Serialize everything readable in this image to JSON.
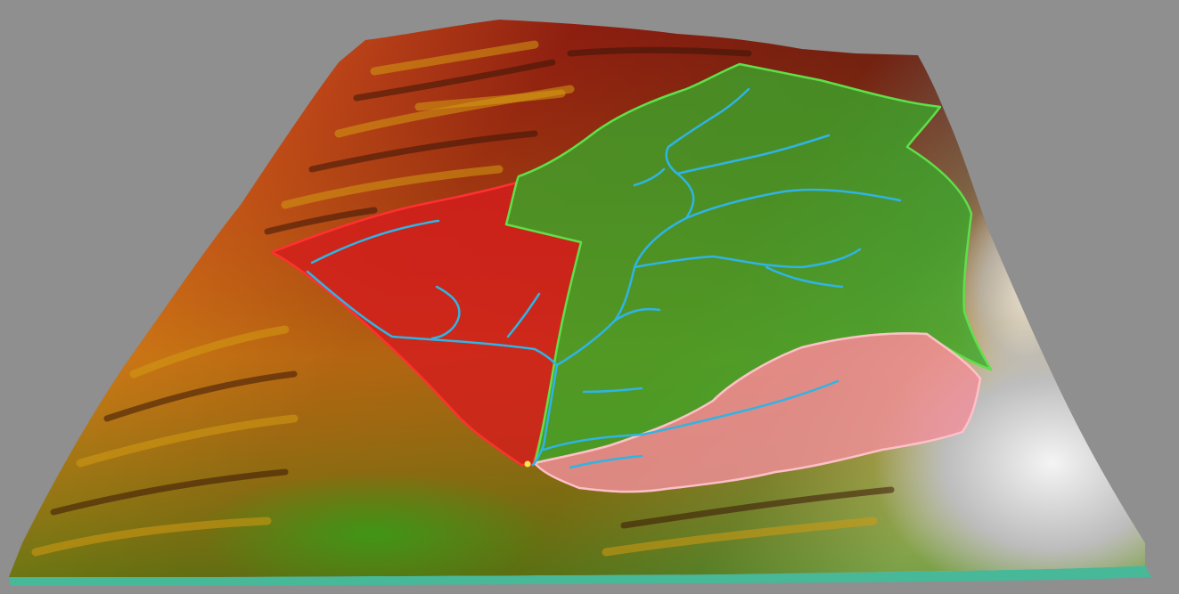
{
  "scene": {
    "background_color": "#8f8f8f",
    "colors": {
      "terrain_low": "#2f7a12",
      "terrain_mid": "#d49a12",
      "terrain_high": "#b51d14",
      "terrain_peak": "#f2f2f2",
      "terrain_shadow": "#3a1608",
      "base_edge": "#3bbf9a",
      "stream": "#2fb4e6",
      "catchment_west_fill": "#d41c1c",
      "catchment_west_outline": "#ff3030",
      "catchment_central_fill": "#3aa82a",
      "catchment_central_outline": "#5fe04a",
      "catchment_south_fill": "#f08f9a",
      "catchment_south_outline": "#ffc0c8",
      "outlet_point": "#f5e64a"
    }
  },
  "map": {
    "terrain_icon": "terrain-hillshade-icon",
    "outlet_icon": "outlet-point-icon",
    "catchments": [
      {
        "id": "west"
      },
      {
        "id": "central"
      },
      {
        "id": "south"
      }
    ]
  }
}
